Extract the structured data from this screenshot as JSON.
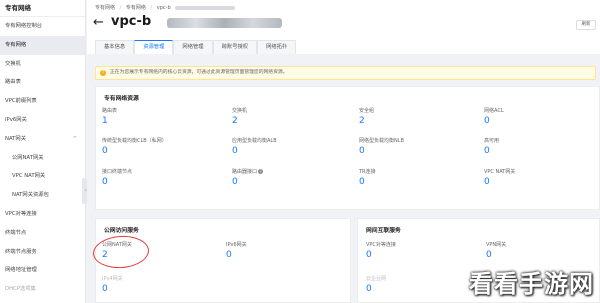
{
  "sidebar": {
    "title": "专有网络",
    "items": [
      {
        "label": "专有网络控制台",
        "active": false
      },
      {
        "label": "专有网络",
        "active": true
      },
      {
        "label": "交换机",
        "active": false
      },
      {
        "label": "路由表",
        "active": false
      },
      {
        "label": "VPC前缀列表",
        "active": false
      },
      {
        "label": "IPv6网关",
        "active": false
      },
      {
        "label": "NAT网关",
        "active": false,
        "caret": "^"
      },
      {
        "label": "公网NAT网关",
        "active": false,
        "sub": true
      },
      {
        "label": "VPC NAT网关",
        "active": false,
        "sub": true
      },
      {
        "label": "NAT网关资源包",
        "active": false,
        "sub": true
      },
      {
        "label": "VPC对等连接",
        "active": false
      },
      {
        "label": "终端节点",
        "active": false
      },
      {
        "label": "终端节点服务",
        "active": false
      },
      {
        "label": "网络地址管理",
        "active": false
      },
      {
        "label": "DHCP选项集",
        "active": false,
        "faded": true
      },
      {
        "label": "公网访问",
        "active": false
      }
    ]
  },
  "breadcrumb": [
    "专有网络",
    "/",
    "专有网络",
    "/",
    "vpc-b"
  ],
  "header": {
    "back_icon": "←",
    "title": "vpc-b",
    "right_button": "刷新"
  },
  "tabs": [
    {
      "label": "基本信息",
      "active": false
    },
    {
      "label": "资源管理",
      "active": true
    },
    {
      "label": "网络管理",
      "active": false
    },
    {
      "label": "跨账号授权",
      "active": false
    },
    {
      "label": "网络拓扑",
      "active": false
    }
  ],
  "notice": "正在为您展示专有网络内的核心云资源，可通过此资源管理页面管理您的网络资源。",
  "vpc_resources": {
    "title": "专有网络资源",
    "rows": [
      [
        {
          "label": "路由表",
          "value": "1"
        },
        {
          "label": "交换机",
          "value": "2"
        },
        {
          "label": "安全组",
          "value": "2"
        },
        {
          "label": "网络ACL",
          "value": "0"
        }
      ],
      [
        {
          "label": "传统型负载均衡CLB（私网）",
          "value": "0"
        },
        {
          "label": "应用型负载均衡ALB",
          "value": "0"
        },
        {
          "label": "网络型负载均衡NLB",
          "value": "0"
        },
        {
          "label": "高可用",
          "value": "0"
        }
      ],
      [
        {
          "label": "接口终端节点",
          "value": "0"
        },
        {
          "label": "路由器接口",
          "value": "0",
          "help": true
        },
        {
          "label": "TR连接",
          "value": "0"
        },
        {
          "label": "VPC NAT网关",
          "value": "0"
        }
      ]
    ]
  },
  "public_access": {
    "title": "公网访问服务",
    "items": [
      {
        "label": "公网NAT网关",
        "value": "2"
      },
      {
        "label": "IPv6网关",
        "value": "0"
      },
      {
        "label": "IPv4网关",
        "value": "0",
        "gray": true
      }
    ]
  },
  "interconnect": {
    "title": "网间互联服务",
    "items": [
      {
        "label": "VPC对等连接",
        "value": "0"
      },
      {
        "label": "VPN网关",
        "value": "0"
      },
      {
        "label": "云企业网",
        "value": "0",
        "gray": true
      }
    ]
  },
  "watermark": "看看手游网",
  "colors": {
    "accent": "#1677ff",
    "highlight_circle": "#e23b3b",
    "notice_bg": "#fffbe6"
  }
}
